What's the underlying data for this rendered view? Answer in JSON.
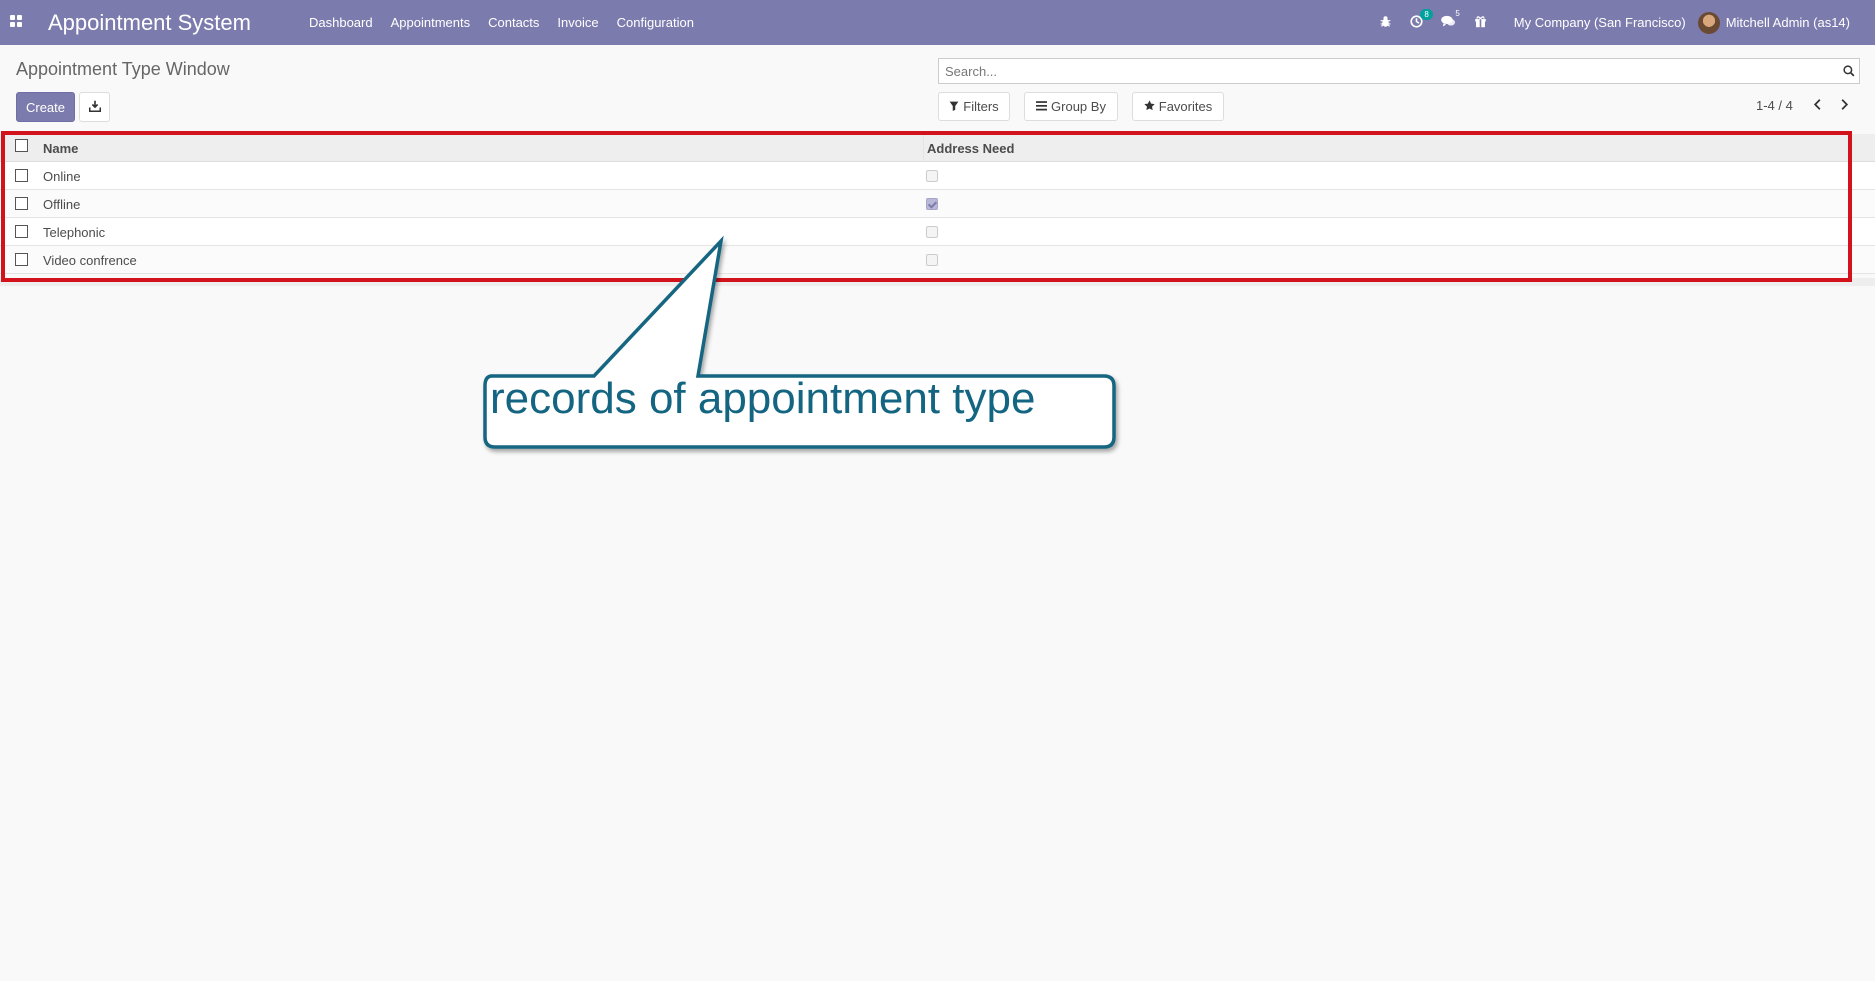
{
  "navbar": {
    "app_title": "Appointment System",
    "menu": [
      "Dashboard",
      "Appointments",
      "Contacts",
      "Invoice",
      "Configuration"
    ],
    "activity_count": "8",
    "messages_count": "5",
    "company": "My Company (San Francisco)",
    "user": "Mitchell Admin (as14)"
  },
  "control_panel": {
    "title": "Appointment Type Window",
    "create_label": "Create",
    "search_placeholder": "Search...",
    "filters_label": "Filters",
    "group_by_label": "Group By",
    "favorites_label": "Favorites",
    "pager": "1-4 / 4"
  },
  "table": {
    "columns": [
      "Name",
      "Address Need"
    ],
    "rows": [
      {
        "name": "Online",
        "address_need": false
      },
      {
        "name": "Offline",
        "address_need": true
      },
      {
        "name": "Telephonic",
        "address_need": false
      },
      {
        "name": "Video confrence",
        "address_need": false
      }
    ]
  },
  "annotation": {
    "callout_text": "records of appointment type",
    "highlight_color": "#d3131c",
    "callout_color": "#136581"
  },
  "colors": {
    "brand": "#7c7bad",
    "badge": "#00a09d"
  }
}
